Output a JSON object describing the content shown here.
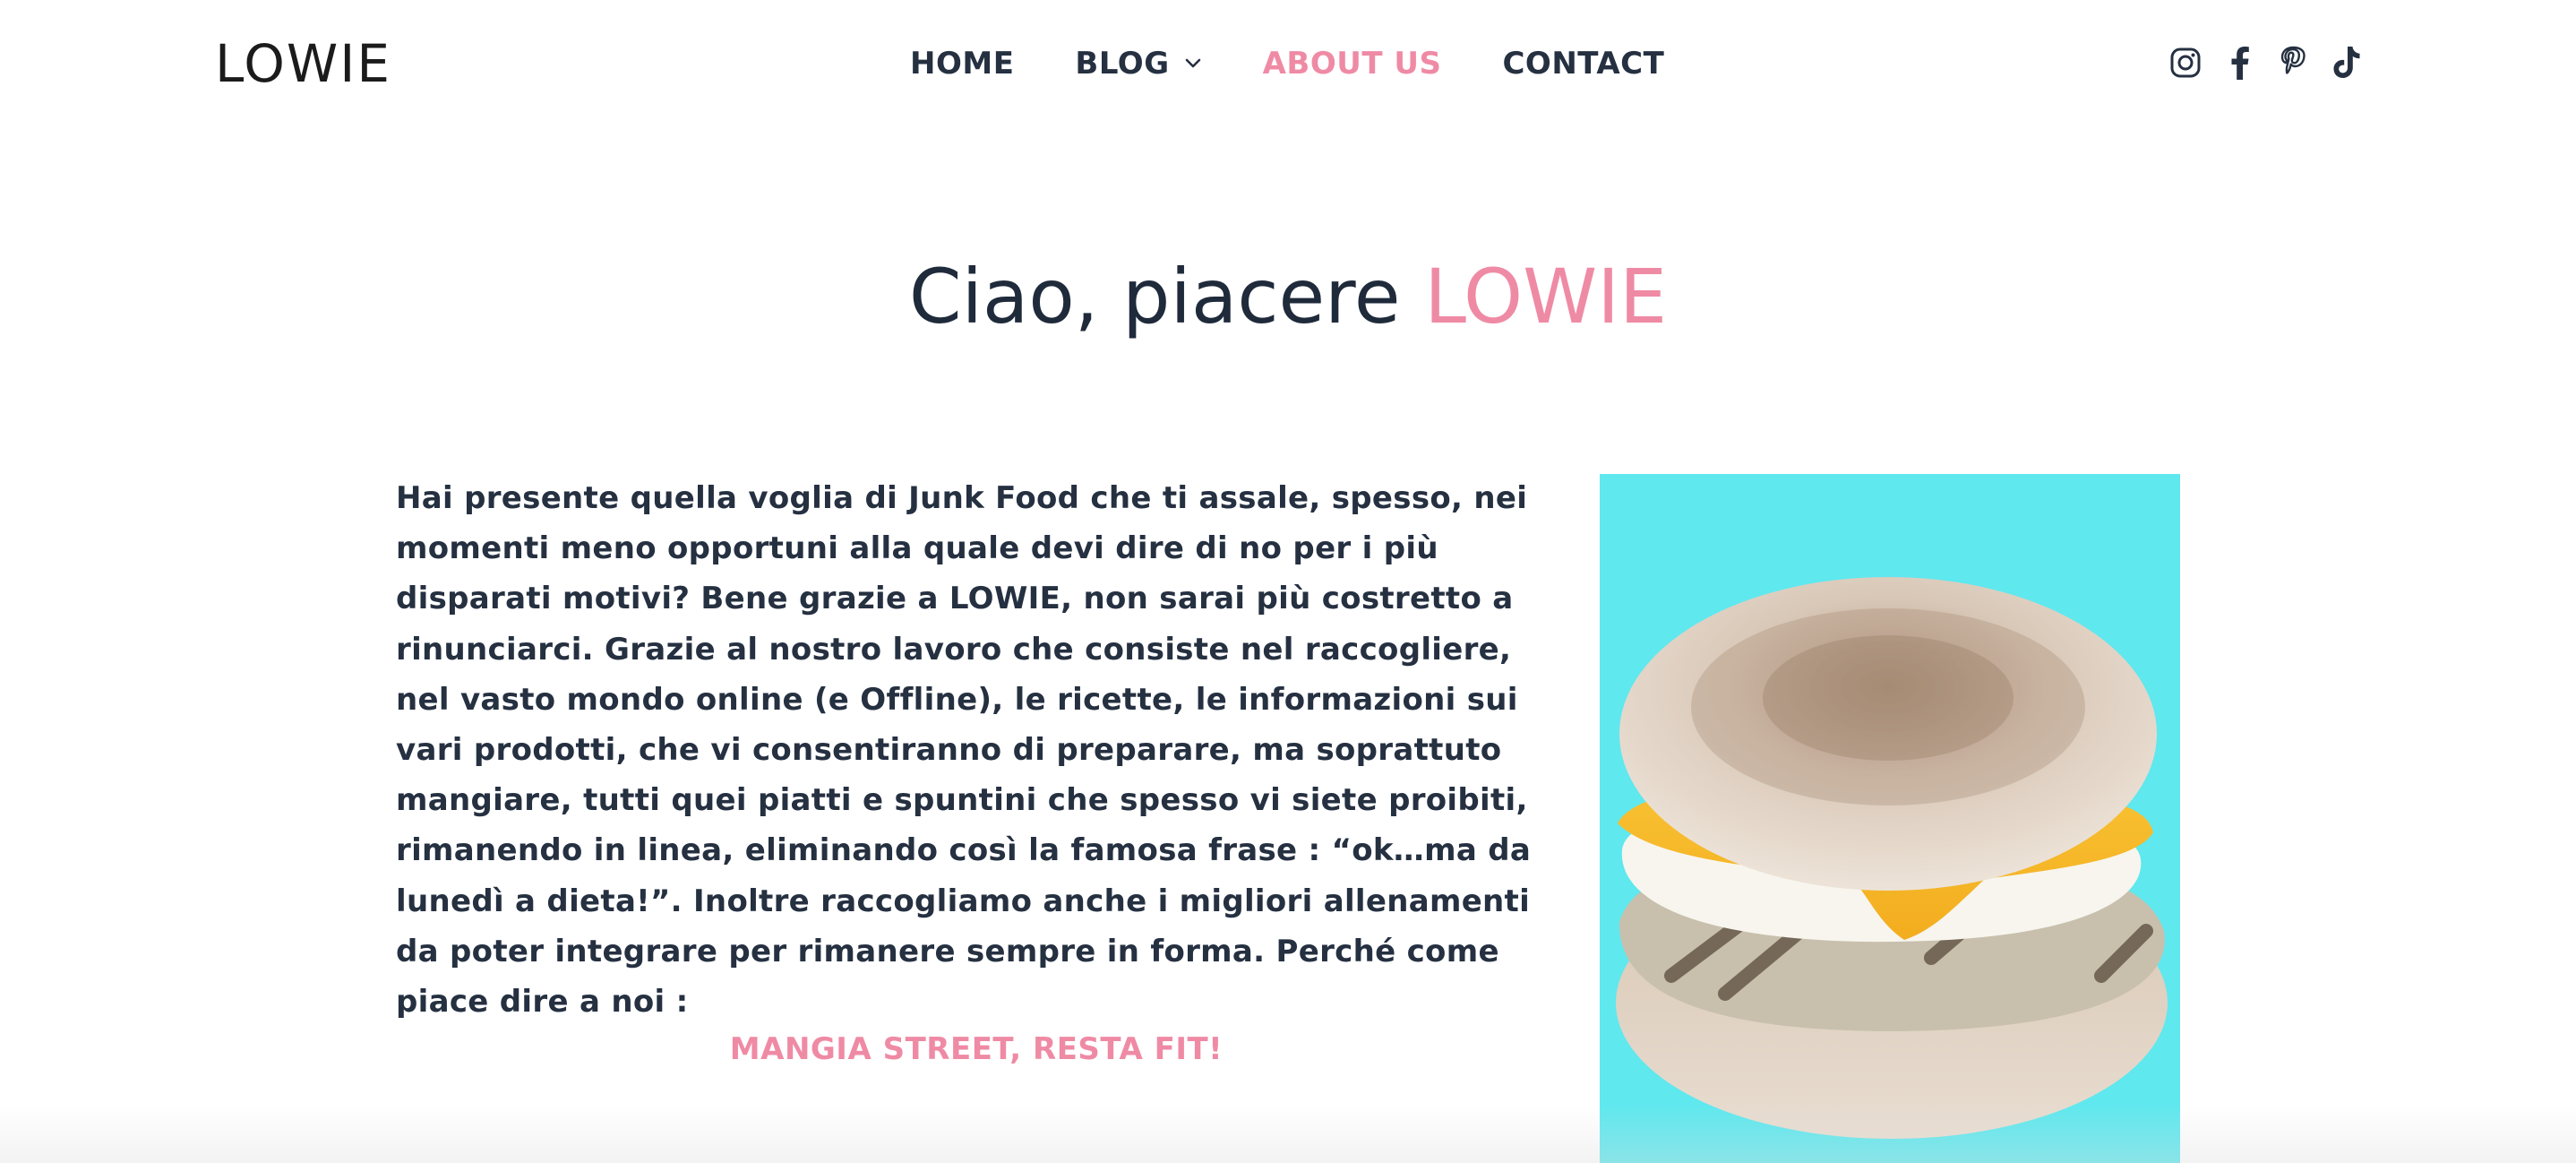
{
  "header": {
    "logo": "LOWIE",
    "nav": {
      "home": "HOME",
      "blog": "BLOG",
      "about": "ABOUT US",
      "contact": "CONTACT"
    },
    "active_item": "ABOUT US",
    "social": [
      "instagram-icon",
      "facebook-icon",
      "pinterest-icon",
      "tiktok-icon"
    ]
  },
  "hero": {
    "title_prefix": "Ciao, piacere",
    "title_brand": "LOWIE"
  },
  "intro": {
    "part1": "Hai presente quella voglia di Junk Food che ti assale, spesso, nei momenti meno opportuni alla quale devi dire di no per i più disparati motivi? Bene grazie a ",
    "brand": "LOWIE",
    "part2": ", non sarai più costretto a rinunciarci. Grazie al nostro lavoro che consiste nel raccogliere, nel vasto mondo online (e Offline), le ricette, le informazioni sui vari prodotti, che vi consentiranno di preparare, ma soprattuto mangiare, tutti quei piatti e spuntini che spesso vi siete proibiti, rimanendo in linea, eliminando così la famosa frase : “ok…ma da lunedì a dieta!”. Inoltre raccogliamo anche i migliori allenamenti da poter integrare per rimanere sempre in forma. Perché come piace dire a noi :"
  },
  "slogan": "MANGIA STREET, RESTA FIT!",
  "colors": {
    "accent": "#ef8aa5",
    "text": "#253041",
    "photo_bg": "#5fe8ee"
  }
}
